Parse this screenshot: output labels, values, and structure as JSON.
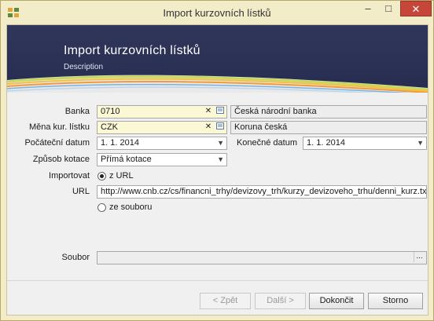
{
  "window": {
    "title": "Import kurzovních lístků",
    "min_glyph": "–",
    "max_glyph": "□",
    "close_glyph": "✕"
  },
  "header": {
    "title": "Import kurzovních lístků",
    "description": "Description"
  },
  "form": {
    "banka_label": "Banka",
    "banka_value": "0710",
    "banka_name": "Česká národní banka",
    "mena_label": "Měna kur. lístku",
    "mena_value": "CZK",
    "mena_name": "Koruna česká",
    "clear_glyph": "✕",
    "pocatecni_label": "Počáteční datum",
    "pocatecni_value": "1. 1. 2014",
    "konecne_label": "Konečné datum",
    "konecne_value": "1. 1. 2014",
    "zpusob_label": "Způsob kotace",
    "zpusob_value": "Přímá kotace",
    "importovat_label": "Importovat",
    "radio_url": "z URL",
    "url_label": "URL",
    "url_value": "http://www.cnb.cz/cs/financni_trhy/devizovy_trh/kurzy_devizoveho_trhu/denni_kurz.txt?date=",
    "radio_file": "ze souboru",
    "soubor_label": "Soubor",
    "soubor_value": "",
    "browse_glyph": "..."
  },
  "buttons": {
    "back": "< Zpět",
    "next": "Další >",
    "finish": "Dokončit",
    "cancel": "Storno"
  },
  "colors": {
    "accent": "#2b3155",
    "close": "#c7463a",
    "field_highlight": "#fbf8d6"
  }
}
